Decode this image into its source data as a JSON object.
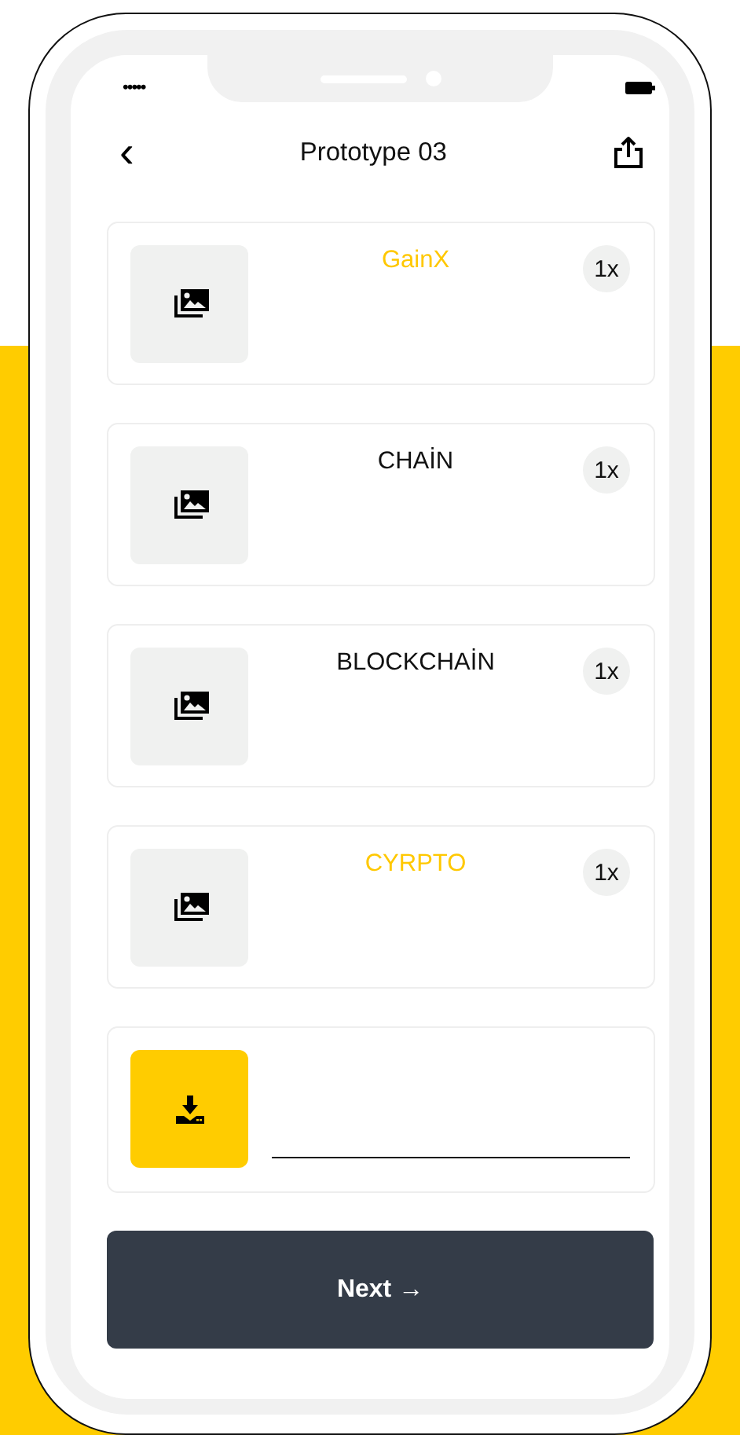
{
  "status_bar": {
    "signal": "•••••"
  },
  "header": {
    "back": "‹",
    "title": "Prototype 03"
  },
  "items": [
    {
      "title": "GainX",
      "count": "1x",
      "selected": true
    },
    {
      "title": "CHAİN",
      "count": "1x",
      "selected": false
    },
    {
      "title": "BLOCKCHAİN",
      "count": "1x",
      "selected": false
    },
    {
      "title": "CYRPTO",
      "count": "1x",
      "selected": true
    }
  ],
  "next_button": {
    "label": "Next →"
  }
}
